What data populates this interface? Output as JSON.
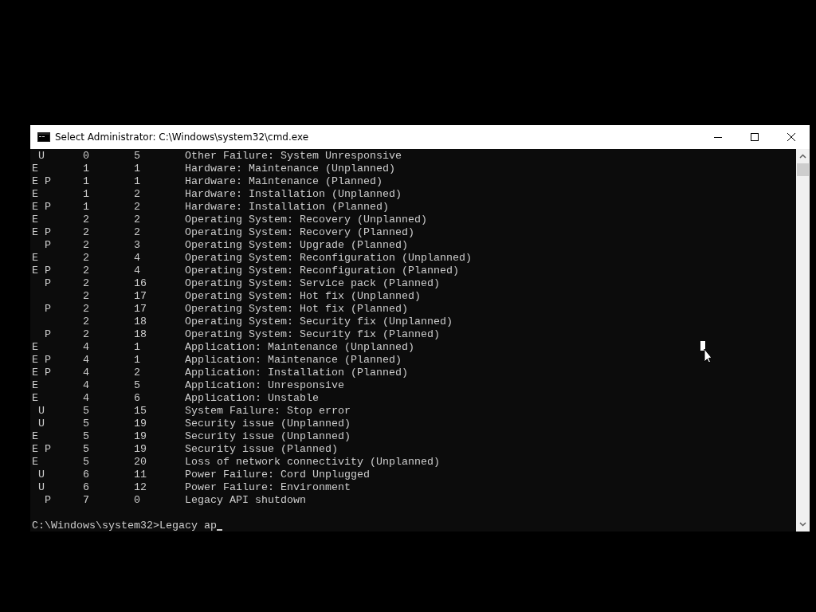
{
  "window": {
    "title": "Select Administrator: C:\\Windows\\system32\\cmd.exe"
  },
  "rows": [
    {
      "flags": " U",
      "major": "0",
      "minor": "5",
      "description": "Other Failure: System Unresponsive"
    },
    {
      "flags": "E",
      "major": "1",
      "minor": "1",
      "description": "Hardware: Maintenance (Unplanned)"
    },
    {
      "flags": "E P",
      "major": "1",
      "minor": "1",
      "description": "Hardware: Maintenance (Planned)"
    },
    {
      "flags": "E",
      "major": "1",
      "minor": "2",
      "description": "Hardware: Installation (Unplanned)"
    },
    {
      "flags": "E P",
      "major": "1",
      "minor": "2",
      "description": "Hardware: Installation (Planned)"
    },
    {
      "flags": "E",
      "major": "2",
      "minor": "2",
      "description": "Operating System: Recovery (Unplanned)"
    },
    {
      "flags": "E P",
      "major": "2",
      "minor": "2",
      "description": "Operating System: Recovery (Planned)"
    },
    {
      "flags": "  P",
      "major": "2",
      "minor": "3",
      "description": "Operating System: Upgrade (Planned)"
    },
    {
      "flags": "E",
      "major": "2",
      "minor": "4",
      "description": "Operating System: Reconfiguration (Unplanned)"
    },
    {
      "flags": "E P",
      "major": "2",
      "minor": "4",
      "description": "Operating System: Reconfiguration (Planned)"
    },
    {
      "flags": "  P",
      "major": "2",
      "minor": "16",
      "description": "Operating System: Service pack (Planned)"
    },
    {
      "major": "2",
      "minor": "17",
      "description": "Operating System: Hot fix (Unplanned)"
    },
    {
      "flags": "  P",
      "major": "2",
      "minor": "17",
      "description": "Operating System: Hot fix (Planned)"
    },
    {
      "major": "2",
      "minor": "18",
      "description": "Operating System: Security fix (Unplanned)"
    },
    {
      "flags": "  P",
      "major": "2",
      "minor": "18",
      "description": "Operating System: Security fix (Planned)"
    },
    {
      "flags": "E",
      "major": "4",
      "minor": "1",
      "description": "Application: Maintenance (Unplanned)"
    },
    {
      "flags": "E P",
      "major": "4",
      "minor": "1",
      "description": "Application: Maintenance (Planned)"
    },
    {
      "flags": "E P",
      "major": "4",
      "minor": "2",
      "description": "Application: Installation (Planned)"
    },
    {
      "flags": "E",
      "major": "4",
      "minor": "5",
      "description": "Application: Unresponsive"
    },
    {
      "flags": "E",
      "major": "4",
      "minor": "6",
      "description": "Application: Unstable"
    },
    {
      "flags": " U",
      "major": "5",
      "minor": "15",
      "description": "System Failure: Stop error"
    },
    {
      "flags": " U",
      "major": "5",
      "minor": "19",
      "description": "Security issue (Unplanned)"
    },
    {
      "flags": "E",
      "major": "5",
      "minor": "19",
      "description": "Security issue (Unplanned)"
    },
    {
      "flags": "E P",
      "major": "5",
      "minor": "19",
      "description": "Security issue (Planned)"
    },
    {
      "flags": "E",
      "major": "5",
      "minor": "20",
      "description": "Loss of network connectivity (Unplanned)"
    },
    {
      "flags": " U",
      "major": "6",
      "minor": "11",
      "description": "Power Failure: Cord Unplugged"
    },
    {
      "flags": " U",
      "major": "6",
      "minor": "12",
      "description": "Power Failure: Environment"
    },
    {
      "flags": "  P",
      "major": "7",
      "minor": "0",
      "description": "Legacy API shutdown"
    }
  ],
  "prompt": {
    "path": "C:\\Windows\\system32>",
    "input": "Legacy ap"
  }
}
